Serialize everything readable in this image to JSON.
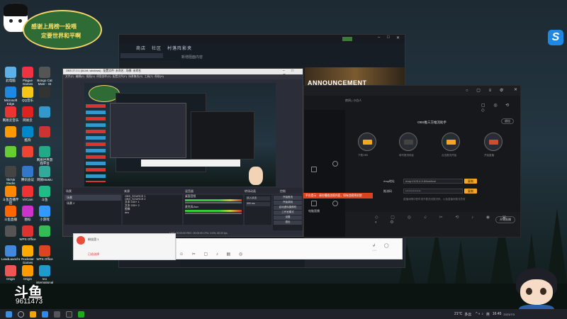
{
  "banner": {
    "line1": "感谢上周榜一投喂",
    "line2": "定要世界和平啊"
  },
  "desktop_icons": [
    {
      "label": "此电脑"
    },
    {
      "label": "Plague Games"
    },
    {
      "label": "Bongo Cat Mver - St"
    },
    {
      "label": "Microsoft Edge"
    },
    {
      "label": "QQ音乐"
    },
    {
      "label": ""
    },
    {
      "label": "网易云音乐"
    },
    {
      "label": "网易云"
    },
    {
      "label": ""
    },
    {
      "label": ""
    },
    {
      "label": "酷狗"
    },
    {
      "label": ""
    },
    {
      "label": ""
    },
    {
      "label": ""
    },
    {
      "label": "网易世界游戏平台"
    },
    {
      "label": "TikTok Studio"
    },
    {
      "label": "腾讯会议"
    },
    {
      "label": "网易MuMu"
    },
    {
      "label": "斗鱼直播伴侣"
    },
    {
      "label": "VirCam"
    },
    {
      "label": "斗鱼"
    },
    {
      "label": "斗鱼直播"
    },
    {
      "label": "图标"
    },
    {
      "label": "小游戏"
    },
    {
      "label": ""
    },
    {
      "label": "WPS Office"
    },
    {
      "label": ""
    },
    {
      "label": "LeadLauncher"
    },
    {
      "label": "Rockstar Games"
    },
    {
      "label": "WPS Office"
    },
    {
      "label": "Origin"
    },
    {
      "label": "Origin"
    },
    {
      "label": "Ieo international"
    }
  ],
  "steam": {
    "nav": [
      "商店",
      "社区",
      "村落阵影夹"
    ],
    "page_label": "新增阻面内容",
    "announcement": "ANNOUNCEMENT"
  },
  "obs": {
    "title": "OBS 27.0.1 (64-bit, windows) - 配置文件: 未命名 - 场景: 未命名",
    "menu": [
      "文件(F)",
      "编辑(E)",
      "视图(V)",
      "停靠部件(D)",
      "配置文件(P)",
      "场景集合(S)",
      "工具(T)",
      "帮助(H)"
    ],
    "docks": [
      "场景",
      "来源",
      "混音器",
      "转场动画",
      "控制"
    ],
    "scenes": [
      "场景",
      "场景 2"
    ],
    "sources": [
      "OBS_SOURCE 1",
      "OBS_SOURCE 2",
      "文本 GDI+ 1",
      "文本 GDI+ 2",
      "图像",
      "dns"
    ],
    "mixer": [
      "桌面音频",
      "麦克风/Aux"
    ],
    "transition": {
      "type": "淡入淡出",
      "duration": "300 ms"
    },
    "controls": [
      "开始推流",
      "开始录制",
      "启动虚拟摄像机",
      "工作室模式",
      "设置",
      "退出"
    ],
    "status": "LIVE: 00:00:00   REC: 00:00:00   CPU: 3.5%, 60.00 fps"
  },
  "live": {
    "tab": "电脑直播",
    "title": "OBS推三方推流助手",
    "button": "退出",
    "rtmp_label": "rtmp地址",
    "rtmp_value": "rtmp://123.4.5.6/live/test",
    "key_label": "推流码",
    "key_value": "**************",
    "copy1": "复制",
    "copy2": "复制",
    "hint": "直播间隔中断时请不要关闭推流码，以免直播间推流异常",
    "start": "开始直播",
    "steps": [
      "下载OBS",
      "填写推流地址",
      "点击推流开始",
      "开始直播"
    ],
    "notice": "平台提示：请勿播放违规内容，如有违规将封禁"
  },
  "chat": {
    "name": "Bilibili",
    "item1": "粉丝团 1",
    "item2": "已经选择"
  },
  "watermark": {
    "logo": "斗鱼",
    "room": "9611473"
  },
  "taskbar": {
    "temp": "21°C",
    "weather": "多云",
    "lang": "英",
    "time": "16:45",
    "date": "2023/7/3"
  },
  "colors": {
    "accent": "#f5a623",
    "obs_bg": "#2b2e38",
    "steam_bg": "#1b2838",
    "live_bg": "#17181c"
  }
}
